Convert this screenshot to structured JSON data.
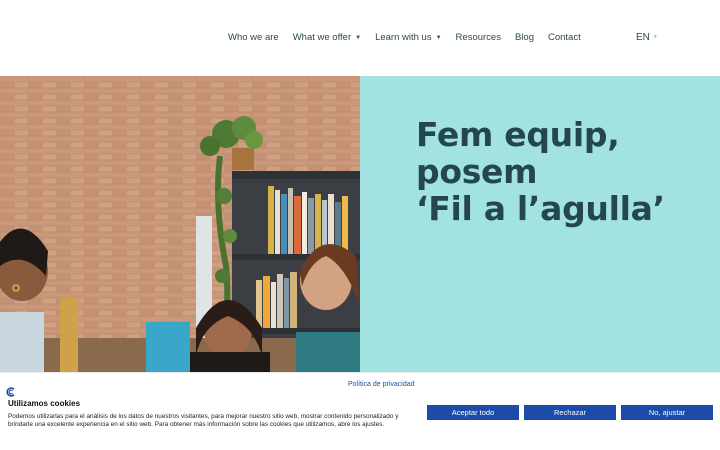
{
  "nav": {
    "items": [
      {
        "label": "Who we are",
        "dropdown": false
      },
      {
        "label": "What we offer",
        "dropdown": true
      },
      {
        "label": "Learn with us",
        "dropdown": true
      },
      {
        "label": "Resources",
        "dropdown": false
      },
      {
        "label": "Blog",
        "dropdown": false
      },
      {
        "label": "Contact",
        "dropdown": false
      }
    ],
    "language": "EN"
  },
  "hero": {
    "headline_line1": "Fem equip,",
    "headline_line2": "posem",
    "headline_line3": "‘Fil a l’agulla’",
    "bg_color": "#a2e3e2"
  },
  "cookie_banner": {
    "privacy_link": "Política de privacidad",
    "title": "Utilizamos cookies",
    "text": "Podemos utilizarlas para el análisis de los datos de nuestros visitantes, para mejorar nuestro sitio web, mostrar contenido personalizado y brindarle una excelente experiencia en el sitio web. Para obtener más información sobre las cookies que utilizamos, abre los ajustes.",
    "accept_label": "Aceptar todo",
    "reject_label": "Rechazar",
    "settings_label": "No, ajustar",
    "button_color": "#1a4ca8"
  }
}
